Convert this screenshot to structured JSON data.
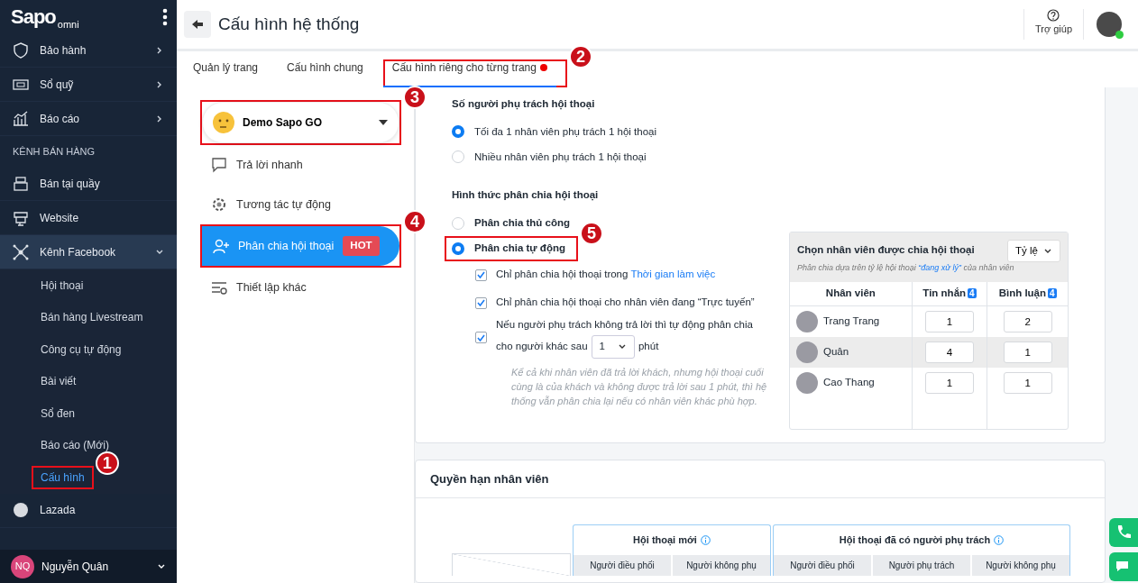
{
  "sidebar": {
    "logo": "Sapo",
    "logo_sub": "omni",
    "items": [
      {
        "label": "Bảo hành",
        "kind": "group",
        "expanded": false
      },
      {
        "label": "Sổ quỹ",
        "kind": "group",
        "expanded": false
      },
      {
        "label": "Báo cáo",
        "kind": "group",
        "expanded": false
      }
    ],
    "section": "KÊNH BÁN HÀNG",
    "channels": [
      {
        "label": "Bán tại quầy",
        "kind": "link"
      },
      {
        "label": "Website",
        "kind": "link"
      },
      {
        "label": "Kênh Facebook",
        "kind": "group",
        "expanded": true,
        "children": [
          {
            "label": "Hội thoại",
            "selected": false
          },
          {
            "label": "Bán hàng Livestream",
            "selected": false
          },
          {
            "label": "Công cụ tự động",
            "selected": false
          },
          {
            "label": "Bài viết",
            "selected": false
          },
          {
            "label": "Sổ đen",
            "selected": false
          },
          {
            "label": "Báo cáo (Mới)",
            "selected": false
          },
          {
            "label": "Cấu hình",
            "selected": true,
            "callout": "1"
          }
        ]
      },
      {
        "label": "Lazada",
        "kind": "link"
      }
    ],
    "user": {
      "initials": "NQ",
      "name": "Nguyễn Quân"
    }
  },
  "header": {
    "title": "Cấu hình hệ thống",
    "help": "Trợ giúp"
  },
  "tabs": [
    {
      "label": "Quản lý trang",
      "selected": false,
      "alert": false
    },
    {
      "label": "Cấu hình chung",
      "selected": false,
      "alert": false
    },
    {
      "label": "Cấu hình riêng cho từng trang",
      "selected": true,
      "alert": true,
      "callout": "2"
    }
  ],
  "page_select": {
    "value": "Demo Sapo GO",
    "callout": "3"
  },
  "settings_menu": [
    {
      "label": "Trả lời nhanh",
      "selected": false
    },
    {
      "label": "Tương tác tự động",
      "selected": false
    },
    {
      "label": "Phân chia hội thoại",
      "selected": true,
      "badge": "HOT",
      "callout": "4"
    },
    {
      "label": "Thiết lập khác",
      "selected": false
    }
  ],
  "assignees": {
    "title": "Số người phụ trách hội thoại",
    "options": [
      {
        "label": "Tối đa 1 nhân viên phụ trách 1 hội thoại",
        "selected": true
      },
      {
        "label": "Nhiều nhân viên phụ trách 1 hội thoại",
        "selected": false
      }
    ]
  },
  "method": {
    "title": "Hình thức phân chia hội thoại",
    "options": [
      {
        "label": "Phân chia thủ công",
        "selected": false
      },
      {
        "label": "Phân chia tự động",
        "selected": true,
        "callout": "5"
      }
    ]
  },
  "auto_options": [
    {
      "checked": true,
      "text": "Chỉ phân chia hội thoại trong",
      "link": "Thời gian làm việc"
    },
    {
      "checked": true,
      "text": "Chỉ phân chia hội thoại cho nhân viên đang “Trực tuyến”"
    },
    {
      "checked": true,
      "text": "Nếu người phụ trách không trả lời thì tự động phân chia",
      "text2": "cho người khác sau",
      "select": "1",
      "suffix": "phút"
    }
  ],
  "note": "Kể cả khi nhân viên đã trả lời khách, nhưng hội thoại cuối cùng là của khách và không được trả lời sau 1 phút, thì hệ thống vẫn phân chia lại nếu có nhân viên khác phù hợp.",
  "staff_panel": {
    "title": "Chọn nhân viên được chia hội thoại",
    "mode": "Tỷ lệ",
    "hint_before": "Phân chia dựa trên tỷ lệ hội thoại",
    "hint_link": "“đang xử lý”",
    "hint_after": "của nhân viên",
    "columns": [
      {
        "label": "Nhân viên"
      },
      {
        "label": "Tin nhắn",
        "count": "4"
      },
      {
        "label": "Bình luận",
        "count": "4"
      }
    ],
    "rows": [
      {
        "name": "Trang Trang",
        "messages": "1",
        "comments": "2",
        "selected": false
      },
      {
        "name": "Quân",
        "messages": "4",
        "comments": "1",
        "selected": true
      },
      {
        "name": "Cao Thang",
        "messages": "1",
        "comments": "1",
        "selected": false
      }
    ]
  },
  "permissions": {
    "title": "Quyền hạn nhân viên",
    "groups": [
      {
        "title": "Hội thoại mới",
        "columns": [
          "Người điều phối",
          "Người không phụ"
        ]
      },
      {
        "title": "Hội thoại đã có người phụ trách",
        "columns": [
          "Người điều phối",
          "Người phụ trách",
          "Người không phụ"
        ]
      }
    ]
  }
}
